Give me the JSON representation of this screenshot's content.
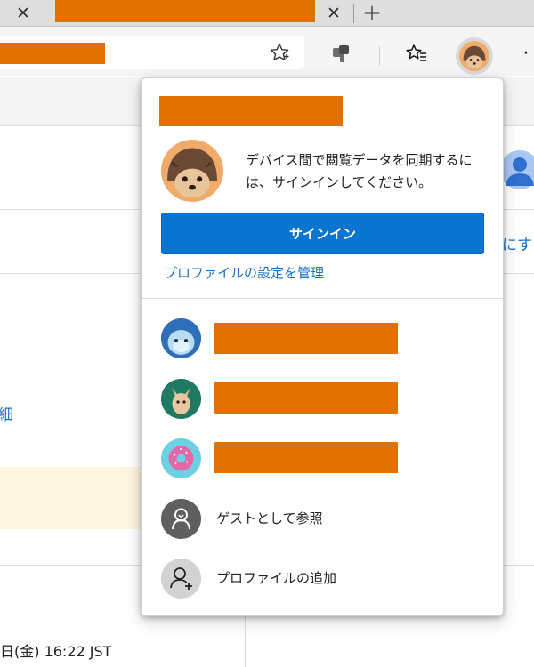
{
  "tabs": {
    "close_glyph": "✕",
    "new_tab_glyph": "+"
  },
  "toolbar": {
    "favorite_icon": "star-outline-icon",
    "collections_icon": "collections-icon",
    "favorites_list_icon": "favorites-list-icon",
    "profile_icon": "hedgehog-avatar-icon",
    "more_glyph": "·"
  },
  "page": {
    "right_partial_text": "にす",
    "left_partial_link": "細",
    "timestamp_text": "日(金) 16:22 JST"
  },
  "flyout": {
    "sync_message": "デバイス間で閲覧データを同期するには、サインインしてください。",
    "signin_label": "サインイン",
    "manage_profile_link": "プロファイルの設定を管理",
    "guest_label": "ゲストとして参照",
    "add_profile_label": "プロファイルの追加"
  },
  "colors": {
    "accent": "#0a75d1",
    "link": "#1a6fc4",
    "redaction": "#e07000"
  }
}
